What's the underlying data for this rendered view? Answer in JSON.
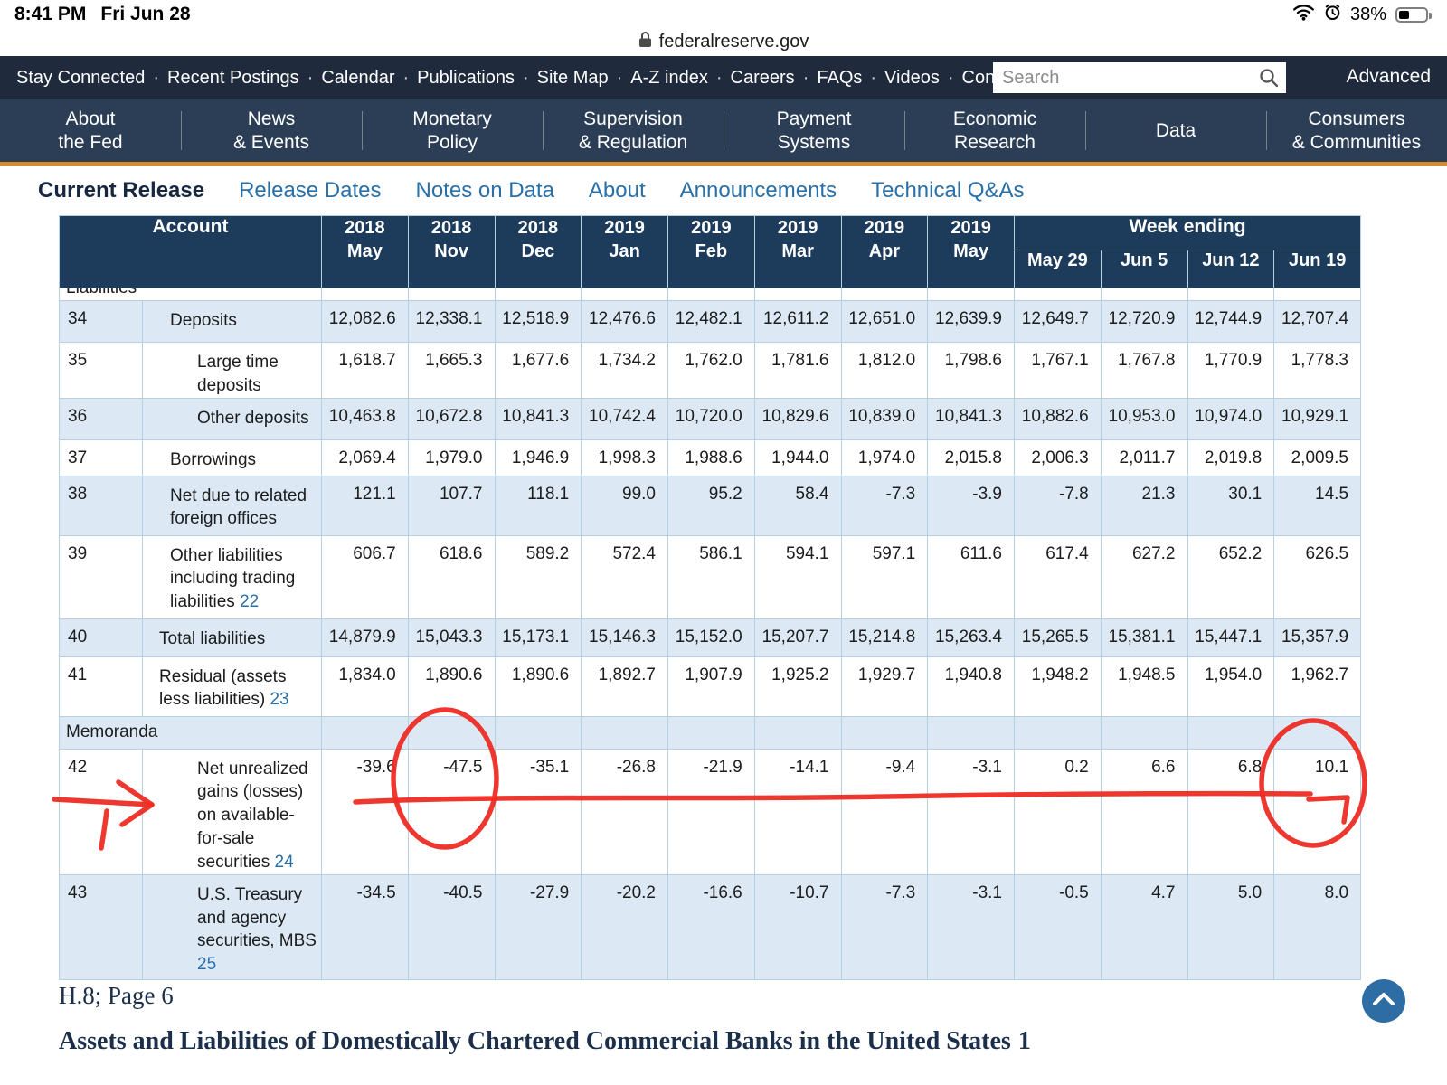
{
  "status_bar": {
    "time": "8:41 PM",
    "date": "Fri Jun 28",
    "battery_percent": "38%"
  },
  "url_bar": {
    "domain": "federalreserve.gov"
  },
  "utility_nav": {
    "items": [
      "Stay Connected",
      "Recent Postings",
      "Calendar",
      "Publications",
      "Site Map",
      "A-Z index",
      "Careers",
      "FAQs",
      "Videos",
      "Contact"
    ],
    "search_placeholder": "Search",
    "advanced_label": "Advanced"
  },
  "main_nav": {
    "items": [
      {
        "lines": [
          "About",
          "the Fed"
        ]
      },
      {
        "lines": [
          "News",
          "& Events"
        ]
      },
      {
        "lines": [
          "Monetary",
          "Policy"
        ]
      },
      {
        "lines": [
          "Supervision",
          "& Regulation"
        ]
      },
      {
        "lines": [
          "Payment",
          "Systems"
        ]
      },
      {
        "lines": [
          "Economic",
          "Research"
        ]
      },
      {
        "lines": [
          "Data"
        ]
      },
      {
        "lines": [
          "Consumers",
          "& Communities"
        ]
      }
    ]
  },
  "sub_nav": {
    "active_index": 0,
    "items": [
      "Current Release",
      "Release Dates",
      "Notes on Data",
      "About",
      "Announcements",
      "Technical Q&As"
    ]
  },
  "table": {
    "account_header": "Account",
    "week_ending_label": "Week ending",
    "month_columns": [
      {
        "year": "2018",
        "month": "May"
      },
      {
        "year": "2018",
        "month": "Nov"
      },
      {
        "year": "2018",
        "month": "Dec"
      },
      {
        "year": "2019",
        "month": "Jan"
      },
      {
        "year": "2019",
        "month": "Feb"
      },
      {
        "year": "2019",
        "month": "Mar"
      },
      {
        "year": "2019",
        "month": "Apr"
      },
      {
        "year": "2019",
        "month": "May"
      }
    ],
    "week_columns": [
      "May 29",
      "Jun 5",
      "Jun 12",
      "Jun 19"
    ],
    "clipped_row_label": "Liabilities",
    "rows": [
      {
        "num": "34",
        "label": "Deposits",
        "indent": 2,
        "values": [
          "12,082.6",
          "12,338.1",
          "12,518.9",
          "12,476.6",
          "12,482.1",
          "12,611.2",
          "12,651.0",
          "12,639.9",
          "12,649.7",
          "12,720.9",
          "12,744.9",
          "12,707.4"
        ]
      },
      {
        "num": "35",
        "label": "Large time deposits",
        "indent": 3,
        "values": [
          "1,618.7",
          "1,665.3",
          "1,677.6",
          "1,734.2",
          "1,762.0",
          "1,781.6",
          "1,812.0",
          "1,798.6",
          "1,767.1",
          "1,767.8",
          "1,770.9",
          "1,778.3"
        ]
      },
      {
        "num": "36",
        "label": "Other deposits",
        "indent": 3,
        "values": [
          "10,463.8",
          "10,672.8",
          "10,841.3",
          "10,742.4",
          "10,720.0",
          "10,829.6",
          "10,839.0",
          "10,841.3",
          "10,882.6",
          "10,953.0",
          "10,974.0",
          "10,929.1"
        ]
      },
      {
        "num": "37",
        "label": "Borrowings",
        "indent": 2,
        "values": [
          "2,069.4",
          "1,979.0",
          "1,946.9",
          "1,998.3",
          "1,988.6",
          "1,944.0",
          "1,974.0",
          "2,015.8",
          "2,006.3",
          "2,011.7",
          "2,019.8",
          "2,009.5"
        ]
      },
      {
        "num": "38",
        "label": "Net due to related foreign offices",
        "indent": 2,
        "values": [
          "121.1",
          "107.7",
          "118.1",
          "99.0",
          "95.2",
          "58.4",
          "-7.3",
          "-3.9",
          "-7.8",
          "21.3",
          "30.1",
          "14.5"
        ]
      },
      {
        "num": "39",
        "label": "Other liabilities including trading liabilities",
        "footnote": "22",
        "indent": 2,
        "values": [
          "606.7",
          "618.6",
          "589.2",
          "572.4",
          "586.1",
          "594.1",
          "597.1",
          "611.6",
          "617.4",
          "627.2",
          "652.2",
          "626.5"
        ]
      },
      {
        "num": "40",
        "label": "Total liabilities",
        "indent": 1,
        "values": [
          "14,879.9",
          "15,043.3",
          "15,173.1",
          "15,146.3",
          "15,152.0",
          "15,207.7",
          "15,214.8",
          "15,263.4",
          "15,265.5",
          "15,381.1",
          "15,447.1",
          "15,357.9"
        ]
      },
      {
        "num": "41",
        "label": "Residual (assets less liabilities)",
        "footnote": "23",
        "indent": 1,
        "values": [
          "1,834.0",
          "1,890.6",
          "1,890.6",
          "1,892.7",
          "1,907.9",
          "1,925.2",
          "1,929.7",
          "1,940.8",
          "1,948.2",
          "1,948.5",
          "1,954.0",
          "1,962.7"
        ]
      },
      {
        "section": true,
        "label": "Memoranda"
      },
      {
        "num": "42",
        "label": "Net unrealized gains (losses) on available-for-sale securities",
        "footnote": "24",
        "indent": 3,
        "values": [
          "-39.6",
          "-47.5",
          "-35.1",
          "-26.8",
          "-21.9",
          "-14.1",
          "-9.4",
          "-3.1",
          "0.2",
          "6.6",
          "6.8",
          "10.1"
        ]
      },
      {
        "num": "43",
        "label": "U.S. Treasury and agency securities, MBS",
        "footnote": "25",
        "indent": 3,
        "values": [
          "-34.5",
          "-40.5",
          "-27.9",
          "-20.2",
          "-16.6",
          "-10.7",
          "-7.3",
          "-3.1",
          "-0.5",
          "4.7",
          "5.0",
          "8.0"
        ]
      }
    ]
  },
  "footer": {
    "page_label": "H.8; Page 6",
    "title": "Assets and Liabilities of Domestically Chartered Commercial Banks in the United States",
    "title_footnote": "1"
  },
  "colors": {
    "nav_bg": "#1f2b3d",
    "nav_bg2": "#2c3d56",
    "accent_orange": "#d8882f",
    "table_header_bg": "#1d3c5c",
    "row_shade": "#dce9f5",
    "link_blue": "#2970a8",
    "active_tab": "#17273f",
    "annotation_red": "#ed2c24",
    "scroll_blue": "#2e6da4"
  }
}
